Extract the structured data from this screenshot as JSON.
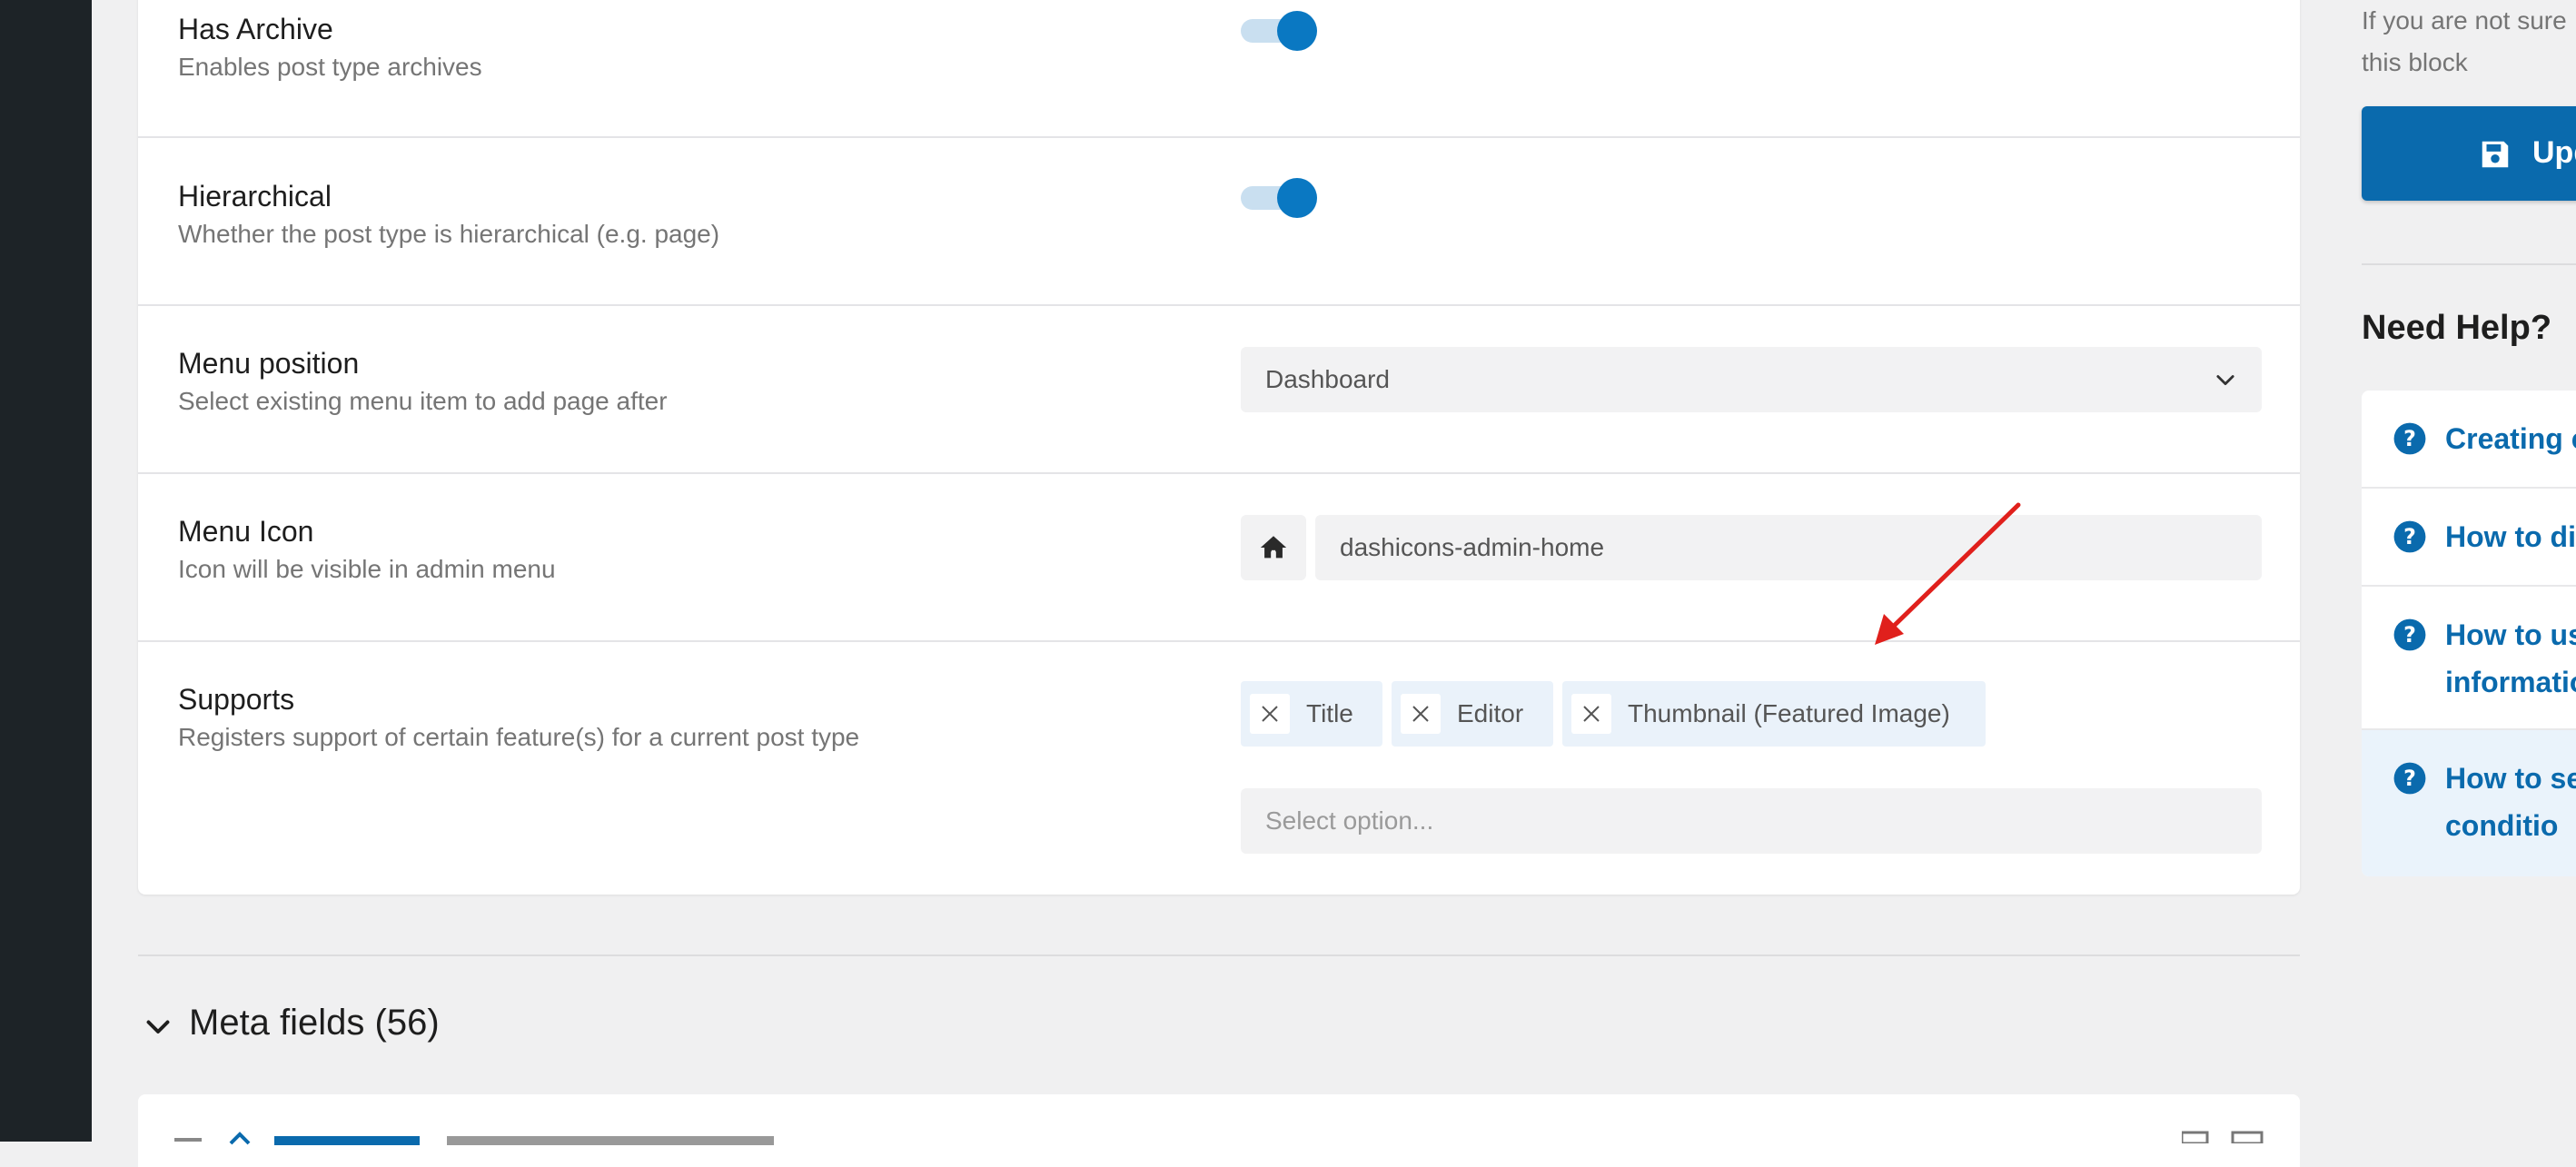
{
  "settings": {
    "has_archive": {
      "label": "Has Archive",
      "description": "Enables post type archives",
      "enabled": true
    },
    "hierarchical": {
      "label": "Hierarchical",
      "description": "Whether the post type is hierarchical (e.g. page)",
      "enabled": true
    },
    "menu_position": {
      "label": "Menu position",
      "description": "Select existing menu item to add page after",
      "value": "Dashboard"
    },
    "menu_icon": {
      "label": "Menu Icon",
      "description": "Icon will be visible in admin menu",
      "value": "dashicons-admin-home",
      "icon": "home-icon"
    },
    "supports": {
      "label": "Supports",
      "description": "Registers support of certain feature(s) for a current post type",
      "tags": [
        "Title",
        "Editor",
        "Thumbnail (Featured Image)"
      ],
      "placeholder": "Select option..."
    }
  },
  "meta_fields": {
    "title": "Meta fields (56)"
  },
  "sidebar": {
    "hint_line1": "If you are not sure",
    "hint_line2": "this block",
    "update_label": "Upd",
    "help_title": "Need Help?",
    "help_items": [
      {
        "line1": "Creating c",
        "line2": ""
      },
      {
        "line1": "How to di",
        "line2": ""
      },
      {
        "line1": "How to us",
        "line2": "informatio"
      },
      {
        "line1": "How to se",
        "line2": "conditio"
      }
    ]
  },
  "colors": {
    "accent": "#0a78c2",
    "button": "#0a6aad",
    "annotation_arrow": "#e0201c"
  }
}
